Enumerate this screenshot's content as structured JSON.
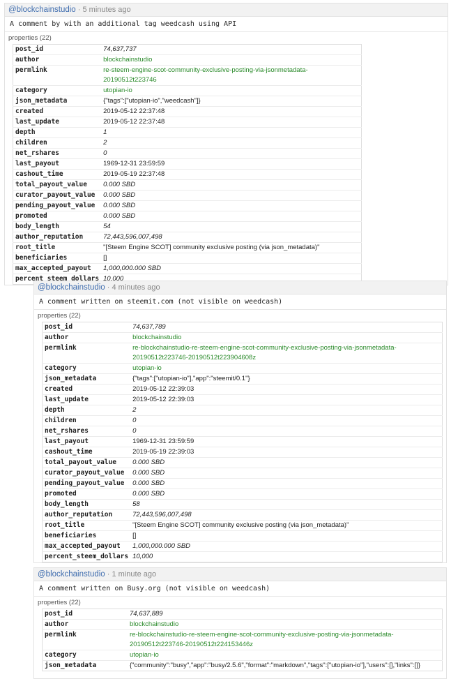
{
  "comments": [
    {
      "author": "@blockchainstudio",
      "sep": "·",
      "time": "5 minutes ago",
      "body": "A comment by with an additional tag weedcash using API",
      "props_label": "properties (22)",
      "props": [
        {
          "k": "post_id",
          "v": "74,637,737",
          "t": "num"
        },
        {
          "k": "author",
          "v": "blockchainstudio",
          "t": "link"
        },
        {
          "k": "permlink",
          "v": "re-steem-engine-scot-community-exclusive-posting-via-jsonmetadata-20190512t223746",
          "t": "link"
        },
        {
          "k": "category",
          "v": "utopian-io",
          "t": "link"
        },
        {
          "k": "json_metadata",
          "v": "{\"tags\":[\"utopian-io\",\"weedcash\"]}",
          "t": "text"
        },
        {
          "k": "created",
          "v": "2019-05-12 22:37:48",
          "t": "text"
        },
        {
          "k": "last_update",
          "v": "2019-05-12 22:37:48",
          "t": "text"
        },
        {
          "k": "depth",
          "v": "1",
          "t": "num"
        },
        {
          "k": "children",
          "v": "2",
          "t": "num"
        },
        {
          "k": "net_rshares",
          "v": "0",
          "t": "num"
        },
        {
          "k": "last_payout",
          "v": "1969-12-31 23:59:59",
          "t": "text"
        },
        {
          "k": "cashout_time",
          "v": "2019-05-19 22:37:48",
          "t": "text"
        },
        {
          "k": "total_payout_value",
          "v": "0.000 SBD",
          "t": "num"
        },
        {
          "k": "curator_payout_value",
          "v": "0.000 SBD",
          "t": "num"
        },
        {
          "k": "pending_payout_value",
          "v": "0.000 SBD",
          "t": "num"
        },
        {
          "k": "promoted",
          "v": "0.000 SBD",
          "t": "num"
        },
        {
          "k": "body_length",
          "v": "54",
          "t": "num"
        },
        {
          "k": "author_reputation",
          "v": "72,443,596,007,498",
          "t": "num"
        },
        {
          "k": "root_title",
          "v": "\"[Steem Engine SCOT] community exclusive posting (via json_metadata)\"",
          "t": "text"
        },
        {
          "k": "beneficiaries",
          "v": "[]",
          "t": "text"
        },
        {
          "k": "max_accepted_payout",
          "v": "1,000,000.000 SBD",
          "t": "num"
        },
        {
          "k": "percent_steem_dollars",
          "v": "10,000",
          "t": "num"
        }
      ]
    },
    {
      "author": "@blockchainstudio",
      "sep": "·",
      "time": "4 minutes ago",
      "body": "A comment written on steemit.com (not visible on weedcash)",
      "props_label": "properties (22)",
      "props": [
        {
          "k": "post_id",
          "v": "74,637,789",
          "t": "num"
        },
        {
          "k": "author",
          "v": "blockchainstudio",
          "t": "link"
        },
        {
          "k": "permlink",
          "v": "re-blockchainstudio-re-steem-engine-scot-community-exclusive-posting-via-jsonmetadata-20190512t223746-20190512t223904608z",
          "t": "link"
        },
        {
          "k": "category",
          "v": "utopian-io",
          "t": "link"
        },
        {
          "k": "json_metadata",
          "v": "{\"tags\":[\"utopian-io\"],\"app\":\"steemit/0.1\"}",
          "t": "text"
        },
        {
          "k": "created",
          "v": "2019-05-12 22:39:03",
          "t": "text"
        },
        {
          "k": "last_update",
          "v": "2019-05-12 22:39:03",
          "t": "text"
        },
        {
          "k": "depth",
          "v": "2",
          "t": "num"
        },
        {
          "k": "children",
          "v": "0",
          "t": "num"
        },
        {
          "k": "net_rshares",
          "v": "0",
          "t": "num"
        },
        {
          "k": "last_payout",
          "v": "1969-12-31 23:59:59",
          "t": "text"
        },
        {
          "k": "cashout_time",
          "v": "2019-05-19 22:39:03",
          "t": "text"
        },
        {
          "k": "total_payout_value",
          "v": "0.000 SBD",
          "t": "num"
        },
        {
          "k": "curator_payout_value",
          "v": "0.000 SBD",
          "t": "num"
        },
        {
          "k": "pending_payout_value",
          "v": "0.000 SBD",
          "t": "num"
        },
        {
          "k": "promoted",
          "v": "0.000 SBD",
          "t": "num"
        },
        {
          "k": "body_length",
          "v": "58",
          "t": "num"
        },
        {
          "k": "author_reputation",
          "v": "72,443,596,007,498",
          "t": "num"
        },
        {
          "k": "root_title",
          "v": "\"[Steem Engine SCOT] community exclusive posting (via json_metadata)\"",
          "t": "text"
        },
        {
          "k": "beneficiaries",
          "v": "[]",
          "t": "text"
        },
        {
          "k": "max_accepted_payout",
          "v": "1,000,000.000 SBD",
          "t": "num"
        },
        {
          "k": "percent_steem_dollars",
          "v": "10,000",
          "t": "num"
        }
      ]
    },
    {
      "author": "@blockchainstudio",
      "sep": "·",
      "time": "1 minute ago",
      "body": "A comment written on Busy.org (not visible on weedcash)",
      "props_label": "properties (22)",
      "props": [
        {
          "k": "post_id",
          "v": "74,637,889",
          "t": "num"
        },
        {
          "k": "author",
          "v": "blockchainstudio",
          "t": "link"
        },
        {
          "k": "permlink",
          "v": "re-blockchainstudio-re-steem-engine-scot-community-exclusive-posting-via-jsonmetadata-20190512t223746-20190512t224153446z",
          "t": "link"
        },
        {
          "k": "category",
          "v": "utopian-io",
          "t": "link"
        },
        {
          "k": "json_metadata",
          "v": "{\"community\":\"busy\",\"app\":\"busy/2.5.6\",\"format\":\"markdown\",\"tags\":[\"utopian-io\"],\"users\":[],\"links\":[]}",
          "t": "text"
        }
      ]
    }
  ]
}
